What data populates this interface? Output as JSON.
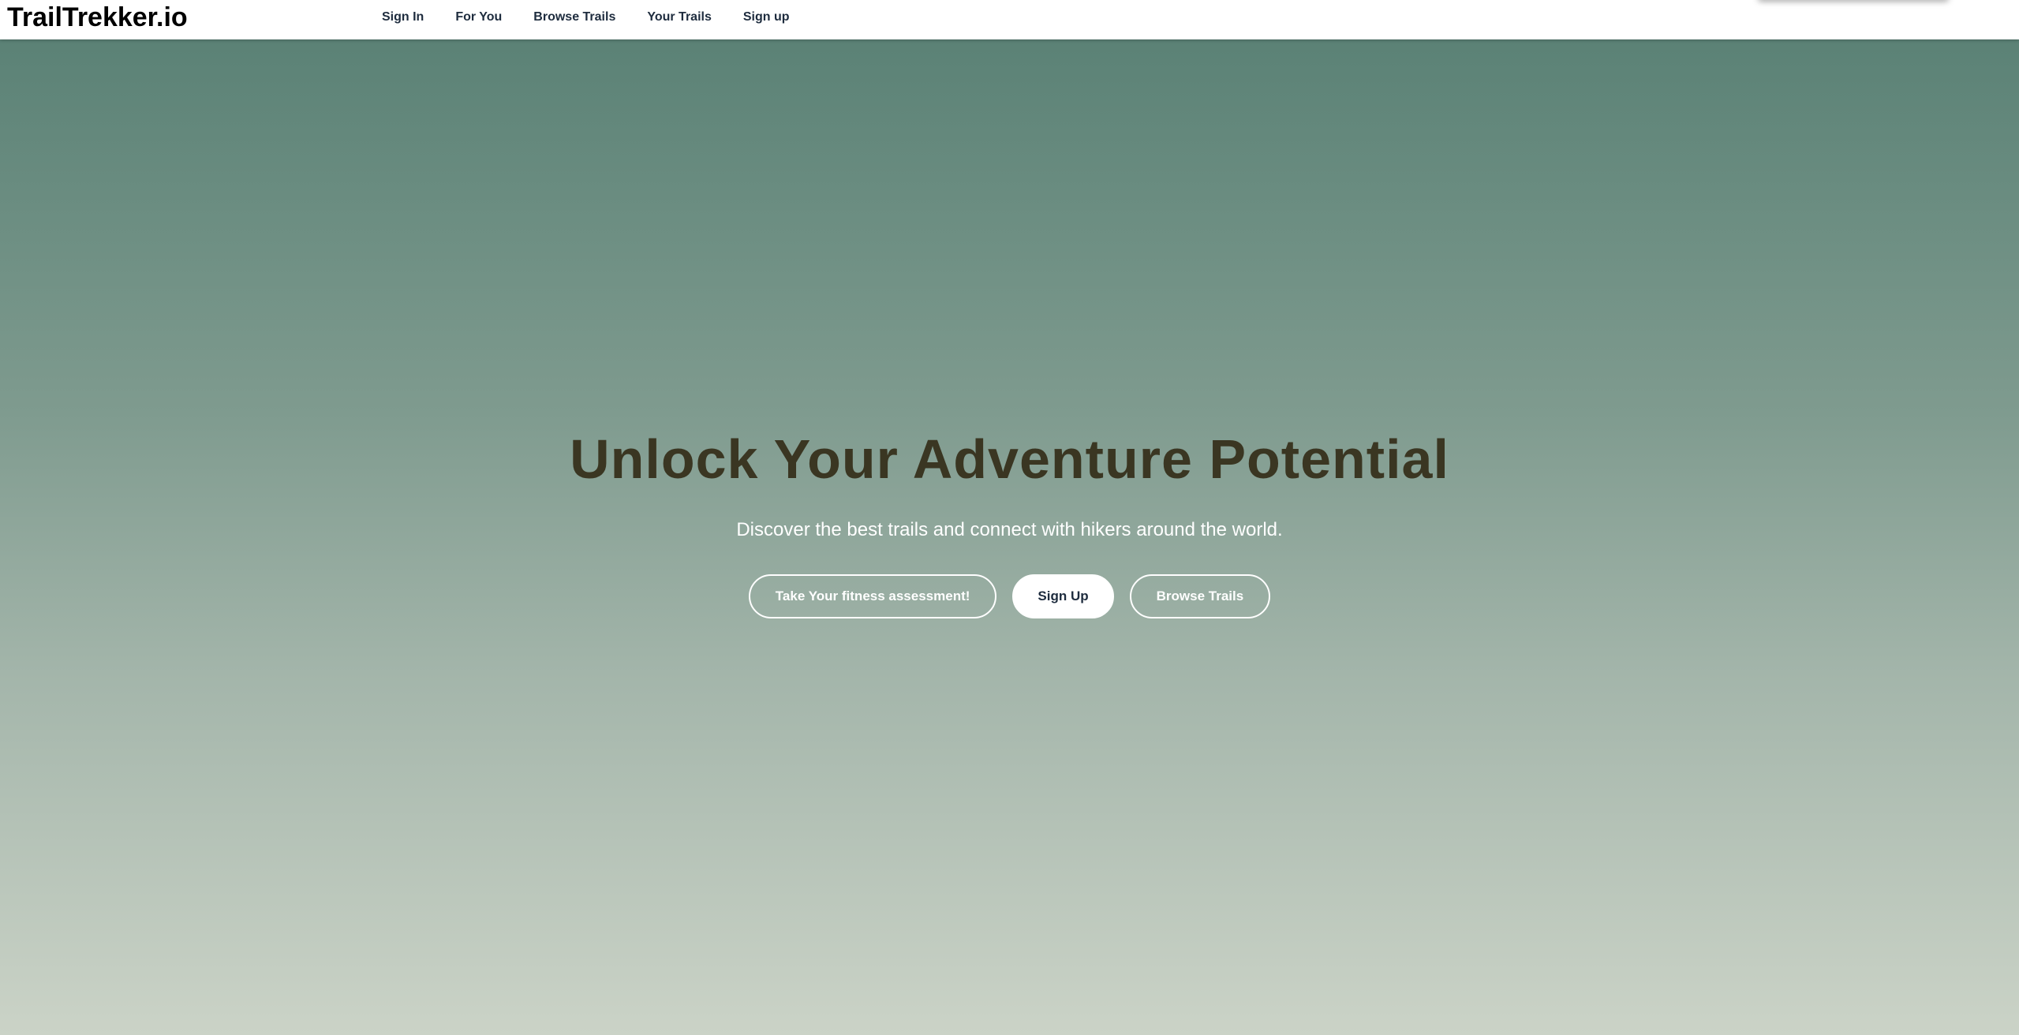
{
  "brand": {
    "name": "TrailTrekker.io"
  },
  "nav": {
    "items": [
      {
        "label": "Sign In"
      },
      {
        "label": "For You"
      },
      {
        "label": "Browse Trails"
      },
      {
        "label": "Your Trails"
      },
      {
        "label": "Sign up"
      }
    ]
  },
  "hero": {
    "title": "Unlock Your Adventure Potential",
    "subtitle": "Discover the best trails and connect with hikers around the world.",
    "buttons": {
      "fitness_label": "Take Your fitness assessment!",
      "signup_label": "Sign Up",
      "browse_label": "Browse Trails"
    }
  },
  "colors": {
    "gradient_top": "#577f73",
    "gradient_bottom": "#cbd3c7",
    "title": "#3a3622",
    "nav_text": "#1e2c3e",
    "button_text_light": "#ffffff"
  }
}
